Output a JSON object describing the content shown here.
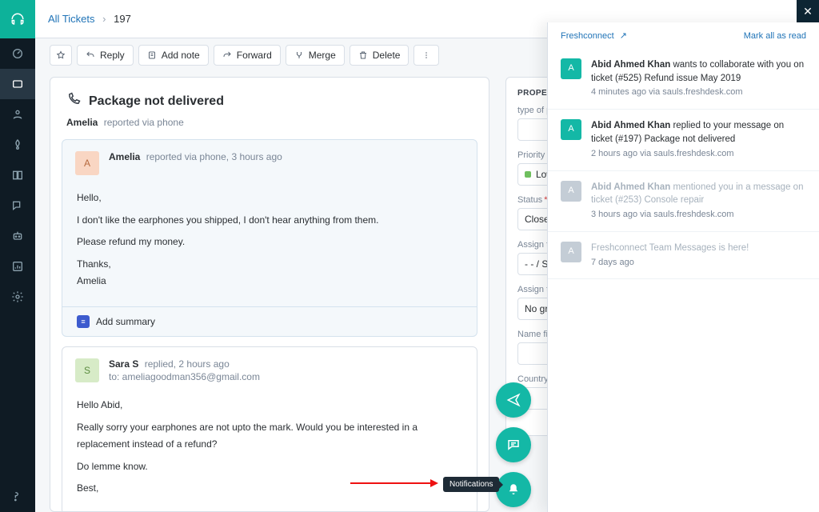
{
  "breadcrumb": {
    "root": "All Tickets",
    "current": "197"
  },
  "toolbar": {
    "reply": "Reply",
    "add_note": "Add note",
    "forward": "Forward",
    "merge": "Merge",
    "delete": "Delete"
  },
  "ticket": {
    "title": "Package not delivered",
    "reporter_name": "Amelia",
    "reporter_tail": "reported via phone"
  },
  "msg1": {
    "avatar_initial": "A",
    "name": "Amelia",
    "meta": "reported via phone, 3 hours ago",
    "p1": "Hello,",
    "p2": "I don't like the earphones you shipped, I don't hear anything from them.",
    "p3": "Please refund my money.",
    "p4a": "Thanks,",
    "p4b": "Amelia",
    "add_summary": "Add summary"
  },
  "msg2": {
    "avatar_initial": "S",
    "name": "Sara S",
    "meta": "replied, 2 hours ago",
    "to": "to: ameliagoodman356@gmail.com",
    "p1": "Hello Abid,",
    "p2": "Really sorry your earphones are not upto the mark. Would you be interested in a replacement instead of a refund?",
    "p3": "Do lemme know.",
    "p4": "Best,"
  },
  "properties": {
    "pane_title": "PROPERTIES",
    "fields": {
      "type": {
        "label": "type of product",
        "value": ""
      },
      "priority": {
        "label": "Priority",
        "value": "Low"
      },
      "status": {
        "label": "Status",
        "required": true,
        "value": "Closed"
      },
      "assign": {
        "label": "Assign to",
        "value": "- - / Sara S"
      },
      "assign_group": {
        "label": "Assign to group",
        "value": "No group"
      },
      "name_field": {
        "label": "Name field",
        "value": ""
      },
      "country": {
        "label": "Country",
        "value": "--"
      }
    }
  },
  "fabs": {
    "tooltip": "Notifications"
  },
  "drawer": {
    "title": "Freshconnect",
    "mark_all": "Mark all as read",
    "items": [
      {
        "initial": "A",
        "avatar": "green",
        "name": "Abid Ahmed Khan",
        "action": "wants to collaborate with you on ticket (#525) Refund issue May 2019",
        "time": "4 minutes ago via sauls.freshdesk.com",
        "read": false
      },
      {
        "initial": "A",
        "avatar": "green",
        "name": "Abid Ahmed Khan",
        "action": "replied to your message on ticket (#197) Package not delivered",
        "time": "2 hours ago via sauls.freshdesk.com",
        "read": false
      },
      {
        "initial": "A",
        "avatar": "grey",
        "name": "Abid Ahmed Khan",
        "action": "mentioned you in a message on ticket (#253) Console repair",
        "time": "3 hours ago via sauls.freshdesk.com",
        "read": true
      },
      {
        "initial": "A",
        "avatar": "grey",
        "name": "",
        "action": "Freshconnect Team Messages is here!",
        "time": "7 days ago",
        "read": true
      }
    ]
  }
}
